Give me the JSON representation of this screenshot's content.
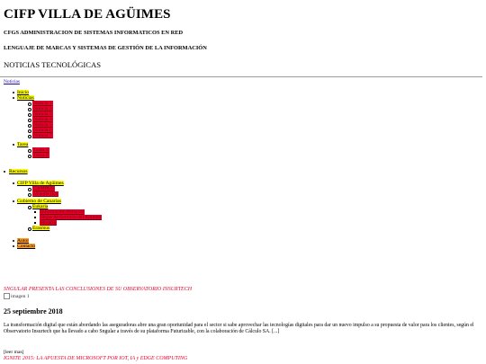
{
  "header": {
    "site_title": "CIFP VILLA DE AGÜIMES",
    "cfgs": "CFGS ADMINISTRACION DE SISTEMAS INFORMATICOS EN RED",
    "lenguaje": "LENGUAJE DE MARCAS Y SISTEMAS DE GESTIÓN DE LA INFORMACIÓN",
    "section": "NOTICIAS TECNOLÓGICAS"
  },
  "breadcrumb": {
    "label": "Noticias"
  },
  "nav": {
    "inicio": "Inicio",
    "noticias": "Noticias",
    "noticias_items": [
      "Noticia 1",
      "Noticia 2",
      "Noticia 3",
      "Noticia 4",
      "Noticia 5",
      "Noticia 6",
      "Noticia 7"
    ],
    "tarea": "Tarea",
    "tarea_items": [
      "Tarea 1",
      "Tarea 2"
    ],
    "recursos": "Recursos",
    "cifp": "CIFP Villa de Agüimes",
    "cifp_items": [
      "CAMPUS",
      "Moodle IES"
    ],
    "gobierno": "Gobierno de Canarias",
    "eukaria": "Eukaria",
    "eukaria_items": [
      "Información Personal",
      "Hojas de Servicio del Alumno",
      "Horario"
    ],
    "erasmus": "Erasmus",
    "autor": "Autor",
    "contacto": "Contacto"
  },
  "article": {
    "title": "SNGULAR PRESENTA LAS CONCLUSIONES DE SU OBSERVATORIO INSURTECH",
    "image_alt": "imagen 1",
    "date": "25 septiembre 2018",
    "body": "La transformación digital que están abordando las aseguradoras abre una gran oportunidad para el sector si sabe aprovechar las tecnologías digitales para dar un nuevo impulso a su propuesta de valor para los clientes, según el Observatorio Insurtech que ha llevado a cabo Sngular a través de su plataforma Futurizable, con la colaboración de Cálculo SA. [...]",
    "read_more": "[leer mas]",
    "next_title": "IGNITE 2015: LA APUESTA DE MICROSOFT POR IOT, IA y EDGE COMPUTING"
  },
  "colors": {
    "highlight_yellow": "#ffff00",
    "highlight_red": "#e8002a",
    "highlight_orange": "#ff9f2e",
    "link": "#1a0dab"
  }
}
